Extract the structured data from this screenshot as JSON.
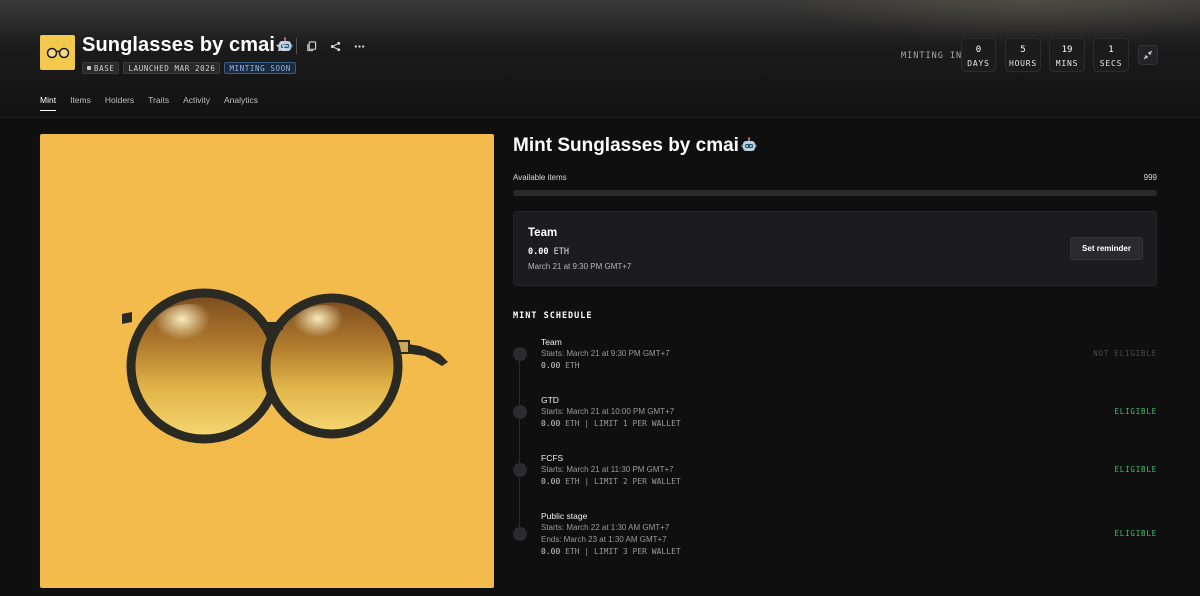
{
  "collection": {
    "name": "Sunglasses by cmai",
    "badges": [
      "BASE",
      "LAUNCHED MAR 2026",
      "MINTING SOON"
    ]
  },
  "countdown": {
    "label": "MINTING IN",
    "units": [
      {
        "value": "0",
        "label": "DAYS"
      },
      {
        "value": "5",
        "label": "HOURS"
      },
      {
        "value": "19",
        "label": "MINS"
      },
      {
        "value": "1",
        "label": "SECS"
      }
    ]
  },
  "tabs": [
    "Mint",
    "Items",
    "Holders",
    "Traits",
    "Activity",
    "Analytics"
  ],
  "active_tab": "Mint",
  "mint": {
    "title": "Mint Sunglasses by cmai",
    "available_label": "Available items",
    "available_count": "999",
    "progress_fraction": 0.0
  },
  "team_card": {
    "name": "Team",
    "price": "0.00",
    "currency": "ETH",
    "date": "March 21 at 9:30 PM GMT+7",
    "button": "Set reminder"
  },
  "schedule": {
    "title": "MINT SCHEDULE",
    "stages": [
      {
        "name": "Team",
        "starts": "Starts: March 21 at 9:30 PM GMT+7",
        "ends": "",
        "price": "0.00",
        "currency": "ETH",
        "limit": "",
        "status": "NOT ELIGIBLE"
      },
      {
        "name": "GTD",
        "starts": "Starts: March 21 at 10:00 PM GMT+7",
        "ends": "",
        "price": "0.00",
        "currency": "ETH",
        "limit": "LIMIT 1 PER WALLET",
        "status": "ELIGIBLE"
      },
      {
        "name": "FCFS",
        "starts": "Starts: March 21 at 11:30 PM GMT+7",
        "ends": "",
        "price": "0.00",
        "currency": "ETH",
        "limit": "LIMIT 2 PER WALLET",
        "status": "ELIGIBLE"
      },
      {
        "name": "Public stage",
        "starts": "Starts: March 22 at 1:30 AM GMT+7",
        "ends": "Ends: March 23 at 1:30 AM GMT+7",
        "price": "0.00",
        "currency": "ETH",
        "limit": "LIMIT 3 PER WALLET",
        "status": "ELIGIBLE"
      }
    ]
  },
  "colors": {
    "art_background": "#f2bb4c",
    "logo_background": "#f2c94c",
    "eligible": "#3fbf6a",
    "not_eligible": "#4a4a4c"
  },
  "icons": [
    "glasses-logo",
    "robot-emoji",
    "star-icon",
    "copy-icon",
    "share-icon",
    "more-icon",
    "expand-icon",
    "sunglasses-artwork"
  ]
}
